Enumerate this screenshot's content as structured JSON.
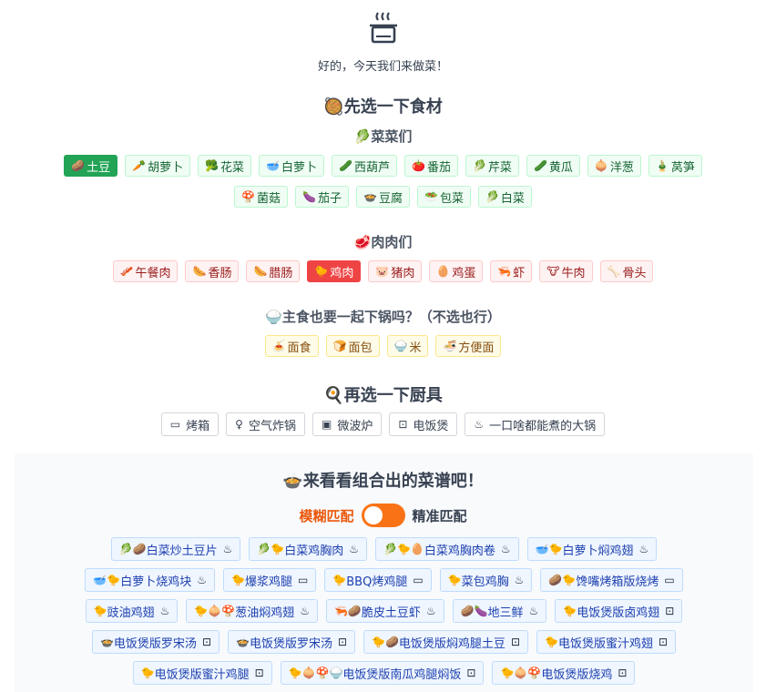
{
  "header": {
    "logo_icon": "pot-icon",
    "subtitle": "好的，今天我们来做菜！"
  },
  "section1": {
    "title": "🥘先选一下食材"
  },
  "vegetables": {
    "title": "🥬菜菜们",
    "row1": [
      {
        "icon": "🥔",
        "label": "土豆",
        "active": true
      },
      {
        "icon": "🥕",
        "label": "胡萝卜"
      },
      {
        "icon": "🥦",
        "label": "花菜"
      },
      {
        "icon": "🥣",
        "label": "白萝卜"
      },
      {
        "icon": "🥒",
        "label": "西葫芦"
      },
      {
        "icon": "🍅",
        "label": "番茄"
      },
      {
        "icon": "🥬",
        "label": "芹菜"
      },
      {
        "icon": "🥒",
        "label": "黄瓜"
      },
      {
        "icon": "🧅",
        "label": "洋葱"
      },
      {
        "icon": "🎍",
        "label": "莴笋"
      }
    ],
    "row2": [
      {
        "icon": "🍄",
        "label": "菌菇"
      },
      {
        "icon": "🍆",
        "label": "茄子"
      },
      {
        "icon": "🍲",
        "label": "豆腐"
      },
      {
        "icon": "🥗",
        "label": "包菜"
      },
      {
        "icon": "🥬",
        "label": "白菜"
      }
    ]
  },
  "meats": {
    "title": "🥩肉肉们",
    "items": [
      {
        "icon": "🥓",
        "label": "午餐肉"
      },
      {
        "icon": "🌭",
        "label": "香肠"
      },
      {
        "icon": "🌭",
        "label": "腊肠"
      },
      {
        "icon": "🐤",
        "label": "鸡肉",
        "active": true
      },
      {
        "icon": "🐷",
        "label": "猪肉"
      },
      {
        "icon": "🥚",
        "label": "鸡蛋"
      },
      {
        "icon": "🦐",
        "label": "虾"
      },
      {
        "icon": "🐮",
        "label": "牛肉"
      },
      {
        "icon": "🦴",
        "label": "骨头"
      }
    ]
  },
  "staples": {
    "title": "🍚主食也要一起下锅吗？（不选也行）",
    "items": [
      {
        "icon": "🍝",
        "label": "面食"
      },
      {
        "icon": "🍞",
        "label": "面包"
      },
      {
        "icon": "🍚",
        "label": "米"
      },
      {
        "icon": "🍜",
        "label": "方便面"
      }
    ]
  },
  "section2": {
    "title": "🍳再选一下厨具"
  },
  "tools": [
    {
      "icon": "▭",
      "icon_name": "oven-icon",
      "label": "烤箱"
    },
    {
      "icon": "♀",
      "icon_name": "air-fryer-icon",
      "label": "空气炸锅"
    },
    {
      "icon": "▣",
      "icon_name": "microwave-icon",
      "label": "微波炉"
    },
    {
      "icon": "⊡",
      "icon_name": "rice-cooker-icon",
      "label": "电饭煲"
    },
    {
      "icon": "♨",
      "icon_name": "pot-icon",
      "label": "一口啥都能煮的大锅"
    }
  ],
  "results": {
    "title": "🍲来看看组合出的菜谱吧！",
    "toggle_left": "模糊匹配",
    "toggle_right": "精准匹配",
    "toggle_on": true,
    "rows": [
      [
        {
          "emoji": "🥬🥔",
          "label": "白菜炒土豆片",
          "tool": "♨"
        },
        {
          "emoji": "🥬🐤",
          "label": "白菜鸡胸肉",
          "tool": "♨"
        },
        {
          "emoji": "🥬🐤🥚",
          "label": "白菜鸡胸肉卷",
          "tool": "♨"
        },
        {
          "emoji": "🥣🐤",
          "label": "白萝卜焖鸡翅",
          "tool": "♨"
        }
      ],
      [
        {
          "emoji": "🥣🐤",
          "label": "白萝卜烧鸡块",
          "tool": "♨"
        },
        {
          "emoji": "🐤",
          "label": "爆浆鸡腿",
          "tool": "▭"
        },
        {
          "emoji": "🐤",
          "label": "BBQ烤鸡腿",
          "tool": "▭"
        },
        {
          "emoji": "🐤",
          "label": "菜包鸡胸",
          "tool": "♨"
        },
        {
          "emoji": "🥔🐤",
          "label": "馋嘴烤箱版烧烤",
          "tool": "▭"
        }
      ],
      [
        {
          "emoji": "🐤",
          "label": "豉油鸡翅",
          "tool": "♨"
        },
        {
          "emoji": "🐤🧅🍄",
          "label": "葱油焖鸡翅",
          "tool": "♨"
        },
        {
          "emoji": "🦐🥔",
          "label": "脆皮土豆虾",
          "tool": "♨"
        },
        {
          "emoji": "🥔🍆",
          "label": "地三鲜",
          "tool": "♨"
        },
        {
          "emoji": "🐤",
          "label": "电饭煲版卤鸡翅",
          "tool": "⊡"
        }
      ],
      [
        {
          "emoji": "🍲",
          "label": "电饭煲版罗宋汤",
          "tool": "⊡"
        },
        {
          "emoji": "🍲",
          "label": "电饭煲版罗宋汤",
          "tool": "⊡"
        },
        {
          "emoji": "🐤🥔",
          "label": "电饭煲版焖鸡腿土豆",
          "tool": "⊡"
        },
        {
          "emoji": "🐤",
          "label": "电饭煲版蜜汁鸡翅",
          "tool": "⊡"
        }
      ],
      [
        {
          "emoji": "🐤",
          "label": "电饭煲版蜜汁鸡腿",
          "tool": "⊡"
        },
        {
          "emoji": "🐤🧅🍄🍚",
          "label": "电饭煲版南瓜鸡腿焖饭",
          "tool": "⊡"
        },
        {
          "emoji": "🐤🧅🍄",
          "label": "电饭煲版烧鸡",
          "tool": "⊡"
        }
      ]
    ]
  }
}
